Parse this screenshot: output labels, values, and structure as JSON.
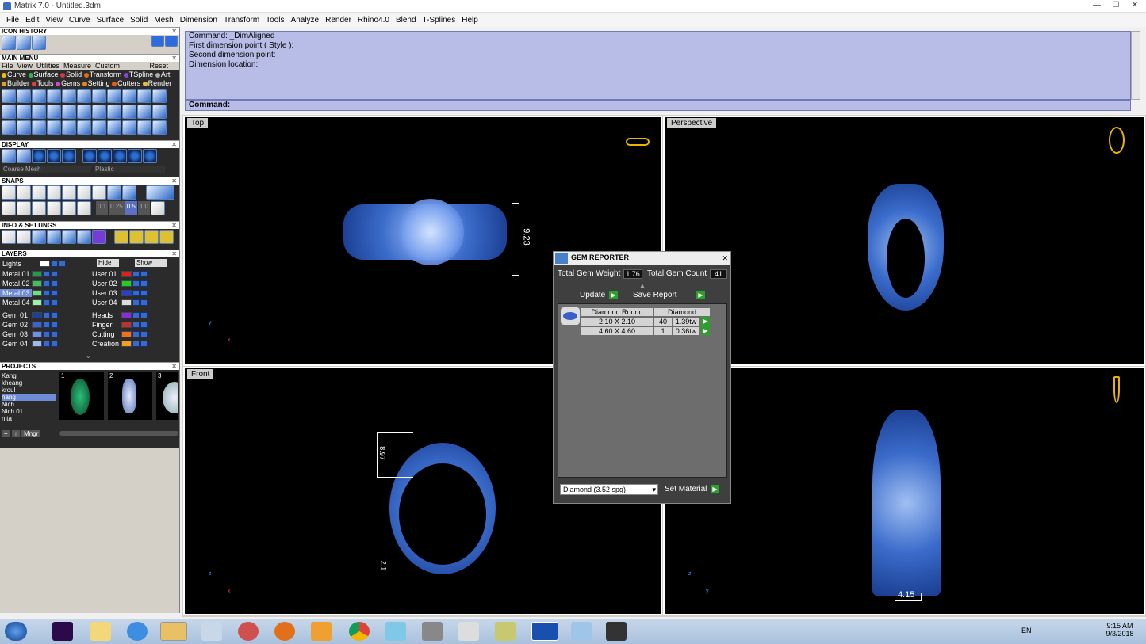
{
  "window": {
    "title": "Matrix 7.0 - Untitled.3dm",
    "min": "—",
    "max": "☐",
    "close": "✕"
  },
  "menus": [
    "File",
    "Edit",
    "View",
    "Curve",
    "Surface",
    "Solid",
    "Mesh",
    "Dimension",
    "Transform",
    "Tools",
    "Analyze",
    "Render",
    "Rhino4.0",
    "Blend",
    "T-Splines",
    "Help"
  ],
  "left": {
    "icon_history": "ICON HISTORY",
    "main_menu": "MAIN MENU",
    "main_tabs": [
      "File",
      "View",
      "Utilities",
      "Measure",
      "Custom"
    ],
    "reset": "Reset",
    "row1": [
      "Curve",
      "Surface",
      "Solid",
      "Transform",
      "TSpline",
      "Art"
    ],
    "row2": [
      "Builder",
      "Tools",
      "Gems",
      "Setting",
      "Cutters",
      "Render"
    ],
    "display": "DISPLAY",
    "display_mode": "Coarse Mesh",
    "material_mode": "Plastic",
    "snaps": "SNAPS",
    "snap_vals": [
      "0.1",
      "0.25",
      "0.5",
      "1.0"
    ],
    "info": "INFO & SETTINGS",
    "layers": "LAYERS",
    "lights": "Lights",
    "hide": "Hide",
    "show": "Show",
    "layer_left": [
      "Metal 01",
      "Metal 02",
      "Metal 03",
      "Metal 04",
      "Gem 01",
      "Gem 02",
      "Gem 03",
      "Gem 04"
    ],
    "layer_right": [
      "User 01",
      "User 02",
      "User 03",
      "User 04",
      "Heads",
      "Finger",
      "Cutting",
      "Creation"
    ],
    "projects": "PROJECTS",
    "project_list": [
      "Kang",
      "kheang",
      "kroul",
      "nang",
      "Nich",
      "Nich 01",
      "nita"
    ],
    "proj_nums": [
      "1",
      "2",
      "3"
    ],
    "mngr": "Mngr"
  },
  "command": {
    "lines": [
      "Command: _DimAligned",
      "First dimension point ( Style ):",
      "Second dimension point:",
      "Dimension location:"
    ],
    "prompt": "Command:"
  },
  "viewports": {
    "top": "Top",
    "perspective": "Perspective",
    "front": "Front"
  },
  "dims": {
    "top": "9.23",
    "front1": "8.97",
    "front2": "2.1",
    "right": "4.15"
  },
  "gem_reporter": {
    "title": "GEM REPORTER",
    "weight_label": "Total Gem Weight",
    "weight": "1.76",
    "count_label": "Total Gem Count",
    "count": "41",
    "update": "Update",
    "save": "Save Report",
    "col1": "Diamond Round",
    "col2": "Diamond",
    "rows": [
      {
        "size": "2.10 X 2.10",
        "qty": "40",
        "tw": "1.39tw"
      },
      {
        "size": "4.60 X 4.60",
        "qty": "1",
        "tw": "0.36tw"
      }
    ],
    "material": "Diamond     (3.52 spg)",
    "set_material": "Set Material"
  },
  "taskbar": {
    "lang": "EN",
    "time": "9:15 AM",
    "date": "9/3/2018"
  }
}
